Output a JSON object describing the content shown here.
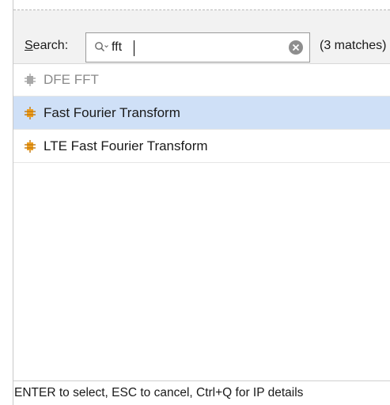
{
  "search": {
    "label_prefix": "S",
    "label_rest": "earch:",
    "query": "fft",
    "match_count": "(3 matches)"
  },
  "results": [
    {
      "label": "DFE FFT",
      "state": "disabled",
      "icon": "ip-core-icon"
    },
    {
      "label": "Fast Fourier Transform",
      "state": "selected",
      "icon": "ip-core-icon"
    },
    {
      "label": "LTE Fast Fourier Transform",
      "state": "normal",
      "icon": "ip-core-icon"
    }
  ],
  "footer": {
    "hint": "ENTER to select, ESC to cancel, Ctrl+Q for IP details"
  },
  "colors": {
    "selection": "#cfe0f7",
    "ip_icon_active": "#f0a020",
    "ip_icon_disabled": "#a8a8a8"
  }
}
